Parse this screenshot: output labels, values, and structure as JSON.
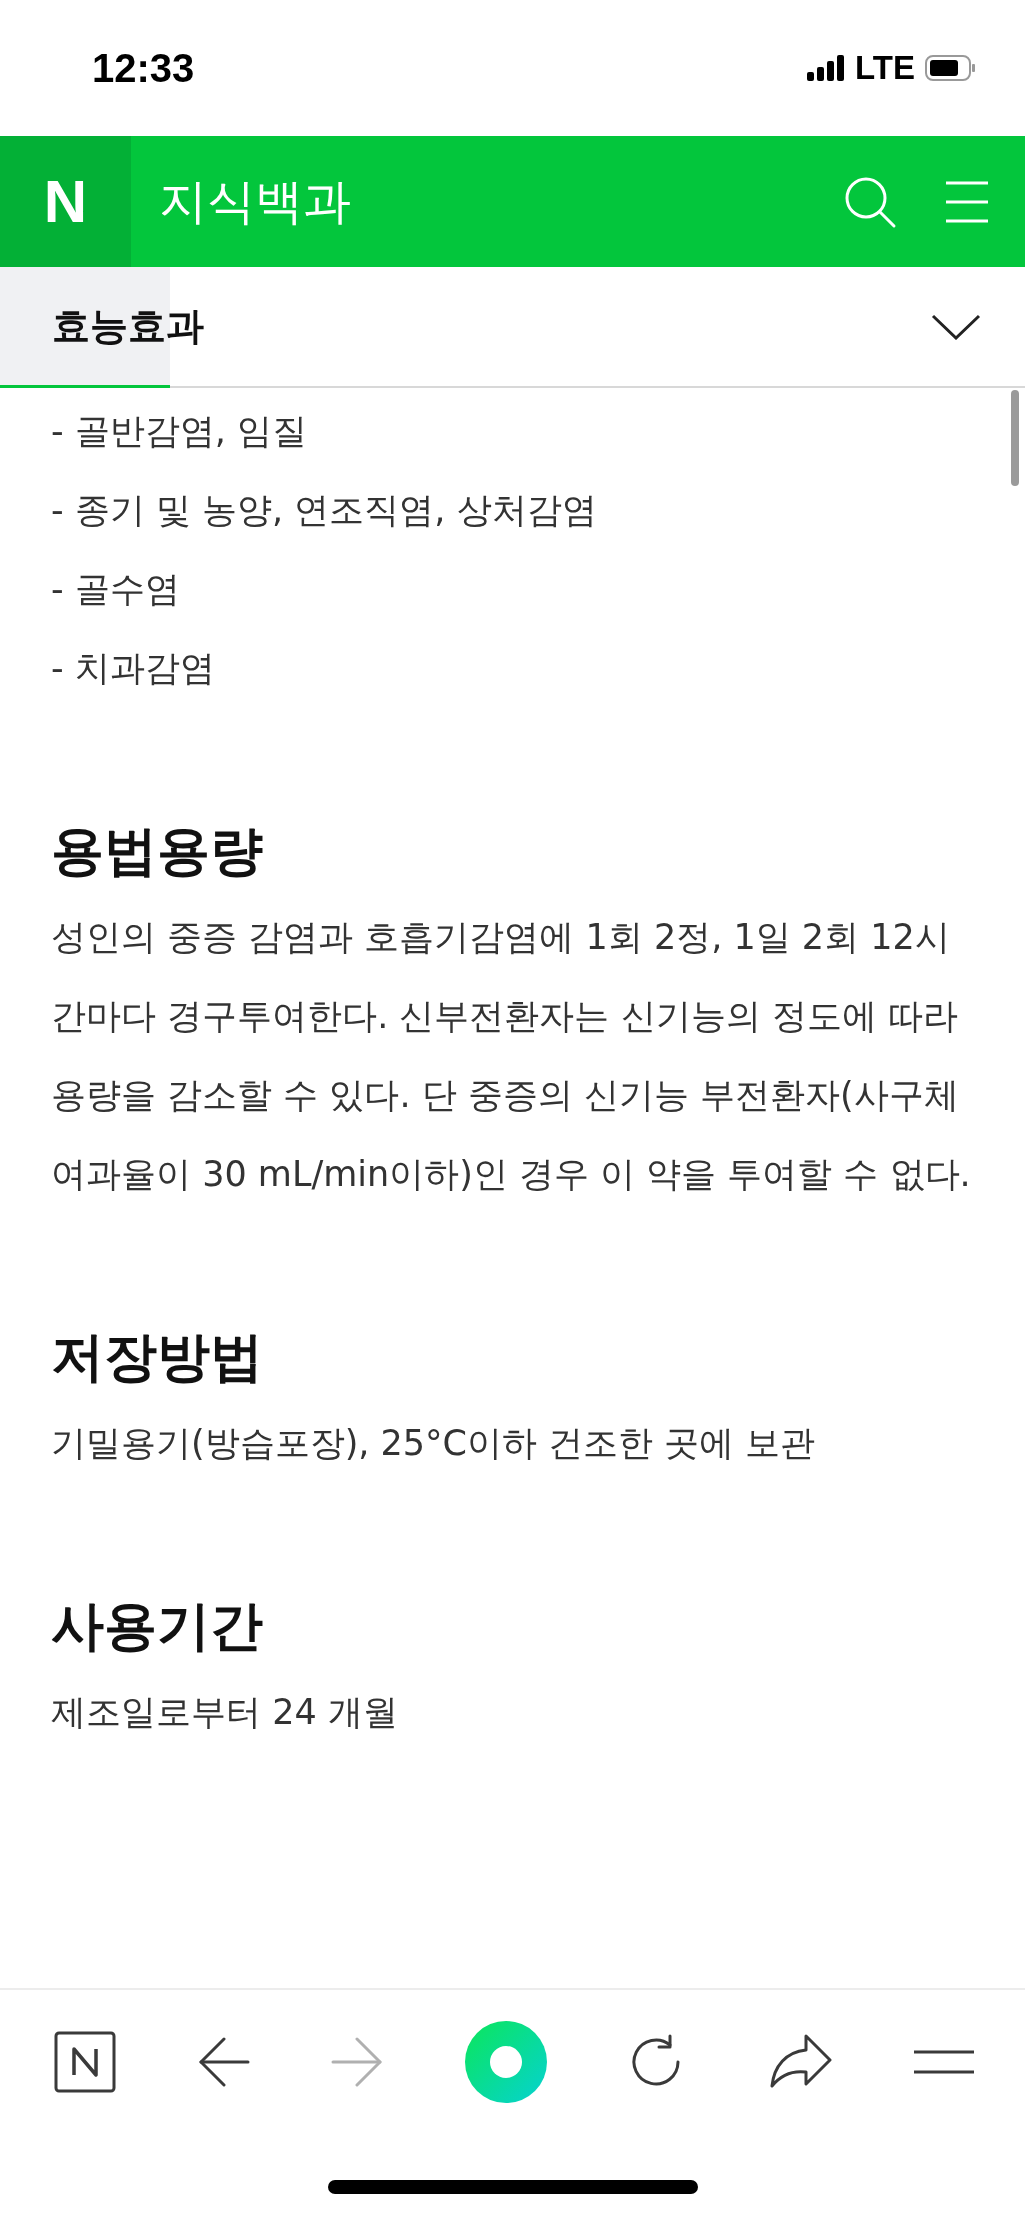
{
  "status_bar": {
    "time": "12:33",
    "network": "LTE"
  },
  "header": {
    "logo": "N",
    "title": "지식백과"
  },
  "section_selector": {
    "label": "효능효과"
  },
  "reading_progress": {
    "level": 0.166
  },
  "list_items": [
    "- 골반감염, 임질",
    "- 종기 및 농양, 연조직염, 상처감염",
    "- 골수염",
    "- 치과감염"
  ],
  "sections": [
    {
      "heading": "용법용량",
      "body": "성인의 중증 감염과 호흡기감염에 1회 2정, 1일 2회 12시간마다 경구투여한다. 신부전환자는 신기능의 정도에 따라 용량을 감소할 수 있다. 단 중증의 신기능 부전환자(사구체여과율이 30 mL/min이하)인 경우 이 약을 투여할 수 없다."
    },
    {
      "heading": "저장방법",
      "body": "기밀용기(방습포장), 25°C이하 건조한 곳에 보관"
    },
    {
      "heading": "사용기간",
      "body": "제조일로부터 24 개월"
    }
  ],
  "toolbar": [
    {
      "kind": "home",
      "disabled": false
    },
    {
      "kind": "back",
      "disabled": false
    },
    {
      "kind": "forward",
      "disabled": true
    },
    {
      "kind": "green-dot",
      "disabled": false
    },
    {
      "kind": "reload",
      "disabled": false
    },
    {
      "kind": "share",
      "disabled": false
    },
    {
      "kind": "menu",
      "disabled": false
    }
  ]
}
